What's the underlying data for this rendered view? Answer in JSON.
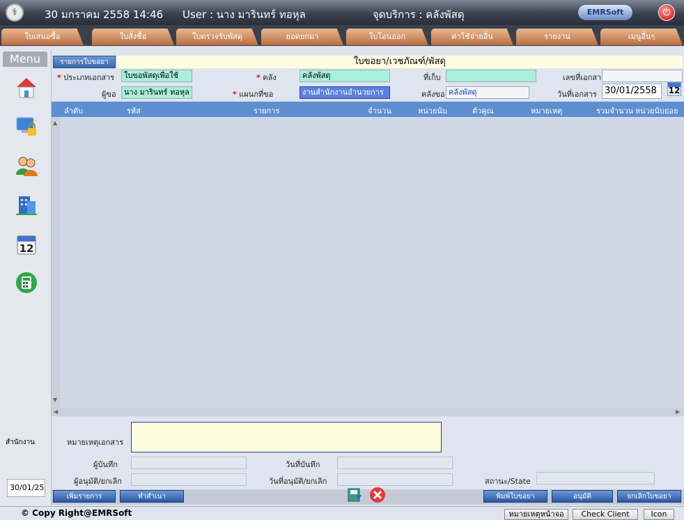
{
  "header": {
    "datetime": "30 มกราคม 2558 14:46",
    "user": "User : นาง มารินทร์ ทอหุล",
    "service_point": "จุดบริการ : คลังพัสดุ",
    "logo_text": "EMRSoft"
  },
  "tabs": [
    "ใบเสนอซื้อ",
    "ใบสั่งซื้อ",
    "ใบตรวจรับพัสดุ",
    "ยอดยกมา",
    "ใบโอนออก",
    "ค่าใช้จ่ายอื่น",
    "รายงาน",
    "เมนูอื่นๆ"
  ],
  "sidebar": {
    "menu_label": "Menu",
    "icons": [
      "home-icon",
      "computer-lock-icon",
      "users-icon",
      "building-icon",
      "calendar-icon",
      "calculator-icon"
    ],
    "calendar_day": "12",
    "dept_text": "สำนักงาน",
    "date_text": "30/01/2558"
  },
  "subtab_label": "รายการใบขอยา",
  "page_title": "ใบขอยา/เวชภัณฑ์/พัสดุ",
  "form": {
    "doc_type_label": "ประเภทเอกสาร",
    "doc_type_value": "ใบขอพัสดุเพื่อใช้",
    "warehouse_label": "คลัง",
    "warehouse_value": "คลังพัสดุ",
    "storage_label": "ที่เก็บ",
    "storage_value": "",
    "doc_no_label": "เลขที่เอกสาร",
    "doc_no_value": "",
    "requester_label": "ผู้ขอ",
    "requester_value": "นาง มารินทร์ ทอหุล",
    "dept_label": "แผนกที่ขอ",
    "dept_value": "งานสำนักงานอำนวยการ",
    "req_wh_label": "คลังขอ",
    "req_wh_value": "คลังพัสดุ",
    "doc_date_label": "วันที่เอกสาร",
    "doc_date_value": "30/01/2558",
    "cal_day": "12"
  },
  "grid": {
    "columns": [
      "ลำดับ",
      "รหัส",
      "รายการ",
      "จำนวน",
      "หน่วยนับ",
      "ตัวคูณ",
      "หมายเหตุ",
      "รวมจำนวน",
      "หน่วยนับย่อย"
    ],
    "rows": []
  },
  "bottom_form": {
    "remark_label": "หมายเหตุเอกสาร",
    "remark_value": "",
    "recorder_label": "ผู้บันทึก",
    "record_date_label": "วันที่บันทึก",
    "approver_label": "ผู้อนุมัติ/ยกเลิก",
    "approve_date_label": "วันที่อนุมัติ/ยกเลิก",
    "state_label": "สถานะ/State"
  },
  "actions": {
    "add_item": "เพิ่มรายการ",
    "copy": "ทำสำเนา",
    "print": "พิมพ์ใบขอยา",
    "approve": "อนุมัติ",
    "cancel": "ยกเลิกใบขอยา"
  },
  "footer": {
    "copyright": "© Copy Right@EMRSoft",
    "remark_page": "หมายเหตุหน้าจอ",
    "check_client": "Check Client",
    "icon": "Icon"
  }
}
